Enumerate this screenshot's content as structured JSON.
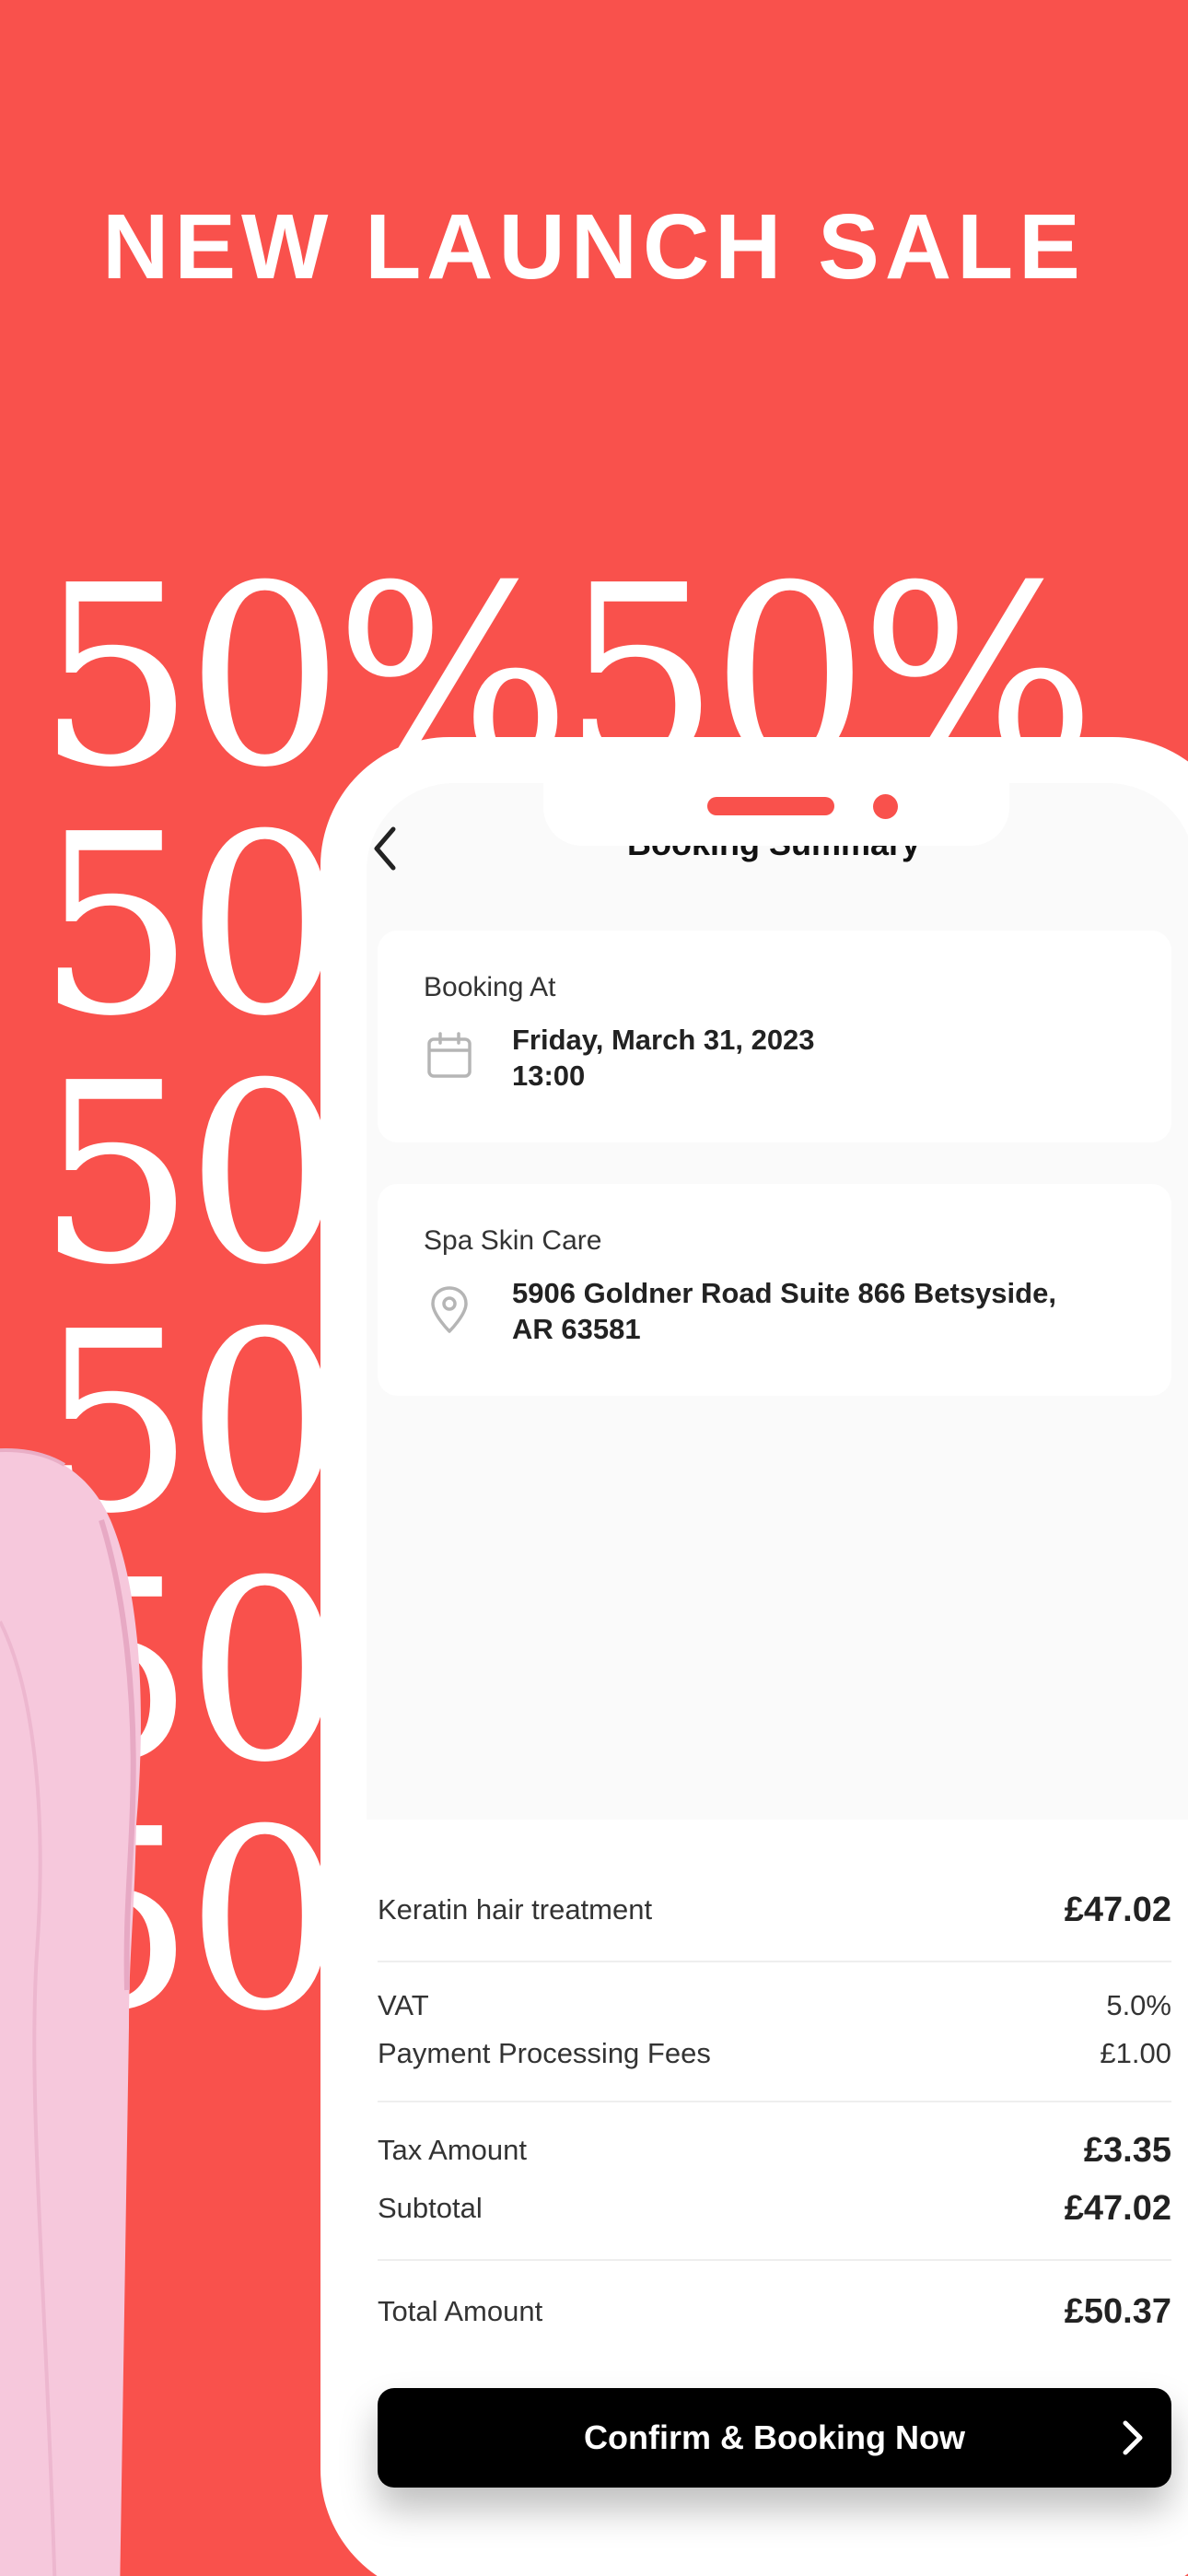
{
  "banner": {
    "headline": "NEW LAUNCH SALE",
    "promo_text": "50%",
    "background_color": "#f9514c"
  },
  "screen": {
    "title": "Booking Summary",
    "back_icon": "chevron-left-icon"
  },
  "booking_card": {
    "label": "Booking At",
    "icon": "calendar-icon",
    "date": "Friday, March 31, 2023",
    "time": "13:00"
  },
  "location_card": {
    "label": "Spa Skin Care",
    "icon": "location-pin-icon",
    "address_line1": "5906 Goldner Road Suite 866 Betsyside,",
    "address_line2": "AR 63581"
  },
  "summary": {
    "service_label": "Keratin hair treatment",
    "service_value": "£47.02",
    "vat_label": "VAT",
    "vat_value": "5.0%",
    "fees_label": "Payment Processing Fees",
    "fees_value": "£1.00",
    "tax_label": "Tax Amount",
    "tax_value": "£3.35",
    "subtotal_label": "Subtotal",
    "subtotal_value": "£47.02",
    "total_label": "Total Amount",
    "total_value": "£50.37"
  },
  "cta": {
    "label": "Confirm & Booking Now",
    "icon": "chevron-right-icon"
  }
}
